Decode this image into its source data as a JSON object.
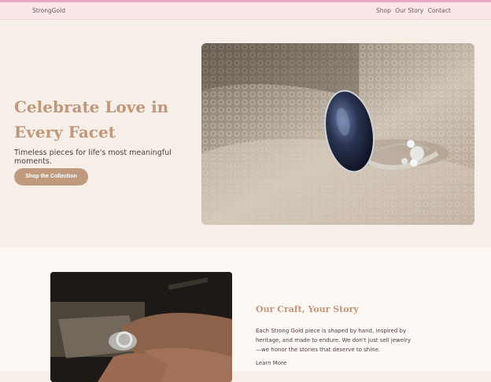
{
  "nav": {
    "brand": "StrongGold",
    "links": [
      "Shop",
      "Our Story",
      "Contact"
    ]
  },
  "hero": {
    "title": "Celebrate Love in Every Facet",
    "subtitle": "Timeless pieces for life's most meaningful moments.",
    "button": "Shop the Collection"
  },
  "about": {
    "title": "Our Craft, Your Story",
    "text": "Each Strong Gold piece is shaped by hand, inspired by heritage, and made to endure. We don't just sell jewelry—we honor the stories that deserve to shine.",
    "link": "Learn More"
  },
  "colors": {
    "accent": "#c1967a",
    "button": "#c09a7e",
    "nav_bg": "#fbe6ea",
    "hero_bg": "#f6efe8",
    "about_bg": "#fdf8f4"
  }
}
